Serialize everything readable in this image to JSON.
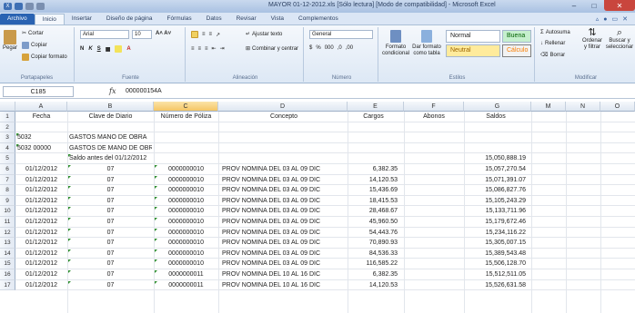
{
  "window": {
    "title": "MAYOR 01-12-2012.xls [Sólo lectura] [Modo de compatibilidad] - Microsoft Excel",
    "controls": [
      "–",
      "□",
      "✕"
    ]
  },
  "tabs": [
    "Archivo",
    "Inicio",
    "Insertar",
    "Diseño de página",
    "Fórmulas",
    "Datos",
    "Revisar",
    "Vista",
    "Complementos"
  ],
  "ribbon": {
    "clipboard": {
      "paste": "Pegar",
      "cut": "Cortar",
      "copy": "Copiar",
      "format_painter": "Copiar formato",
      "label": "Portapapeles"
    },
    "font": {
      "name": "Arial",
      "size": "10",
      "label": "Fuente"
    },
    "alignment": {
      "wrap": "Ajustar texto",
      "merge": "Combinar y centrar",
      "label": "Alineación"
    },
    "number": {
      "format": "General",
      "label": "Número"
    },
    "styles": {
      "conditional": "Formato condicional",
      "table": "Dar formato como tabla",
      "normal": "Normal",
      "good": "Buena",
      "neutral": "Neutral",
      "calc": "Cálculo",
      "label": "Estilos"
    },
    "cells": {
      "autosum": "Autosuma",
      "fill": "Rellenar",
      "clear": "Borrar",
      "sort": "Ordenar y filtrar",
      "find": "Buscar y seleccionar",
      "label": "Modificar"
    }
  },
  "formula_bar": {
    "name_box": "C185",
    "fx": "fx",
    "value": "000000154A"
  },
  "columns": [
    "A",
    "B",
    "C",
    "D",
    "E",
    "F",
    "G",
    "M",
    "N",
    "O"
  ],
  "rows": [
    {
      "n": "1",
      "a": "Fecha",
      "b": "Clave de Diario",
      "c": "Número de Póliza",
      "d": "Concepto",
      "e": "Cargos",
      "f": "Abonos",
      "g": "Saldos",
      "header": true
    },
    {
      "n": "2"
    },
    {
      "n": "3",
      "a": "5032",
      "b": "GASTOS MANO DE OBRA",
      "atri": true
    },
    {
      "n": "4",
      "a": "5032 00000",
      "b": "GASTOS DE MANO DE OBRA DIRECTA",
      "atri": true
    },
    {
      "n": "5",
      "b": "Saldo antes del 01/12/2012",
      "g": "15,050,888.19",
      "btri": true
    },
    {
      "n": "6",
      "a": "01/12/2012",
      "b": "07",
      "c": "0000000010",
      "d": "PROV NOMINA DEL 03 AL 09 DIC",
      "e": "6,382.35",
      "g": "15,057,270.54"
    },
    {
      "n": "7",
      "a": "01/12/2012",
      "b": "07",
      "c": "0000000010",
      "d": "PROV NOMINA DEL 03 AL 09 DIC",
      "e": "14,120.53",
      "g": "15,071,391.07"
    },
    {
      "n": "8",
      "a": "01/12/2012",
      "b": "07",
      "c": "0000000010",
      "d": "PROV NOMINA DEL 03 AL 09 DIC",
      "e": "15,436.69",
      "g": "15,086,827.76"
    },
    {
      "n": "9",
      "a": "01/12/2012",
      "b": "07",
      "c": "0000000010",
      "d": "PROV NOMINA DEL 03 AL 09 DIC",
      "e": "18,415.53",
      "g": "15,105,243.29"
    },
    {
      "n": "10",
      "a": "01/12/2012",
      "b": "07",
      "c": "0000000010",
      "d": "PROV NOMINA DEL 03 AL 09 DIC",
      "e": "28,468.67",
      "g": "15,133,711.96"
    },
    {
      "n": "11",
      "a": "01/12/2012",
      "b": "07",
      "c": "0000000010",
      "d": "PROV NOMINA DEL 03 AL 09 DIC",
      "e": "45,960.50",
      "g": "15,179,672.46"
    },
    {
      "n": "12",
      "a": "01/12/2012",
      "b": "07",
      "c": "0000000010",
      "d": "PROV NOMINA DEL 03 AL 09 DIC",
      "e": "54,443.76",
      "g": "15,234,116.22"
    },
    {
      "n": "13",
      "a": "01/12/2012",
      "b": "07",
      "c": "0000000010",
      "d": "PROV NOMINA DEL 03 AL 09 DIC",
      "e": "70,890.93",
      "g": "15,305,007.15"
    },
    {
      "n": "14",
      "a": "01/12/2012",
      "b": "07",
      "c": "0000000010",
      "d": "PROV NOMINA DEL 03 AL 09 DIC",
      "e": "84,536.33",
      "g": "15,389,543.48"
    },
    {
      "n": "15",
      "a": "01/12/2012",
      "b": "07",
      "c": "0000000010",
      "d": "PROV NOMINA DEL 03 AL 09 DIC",
      "e": "116,585.22",
      "g": "15,506,128.70"
    },
    {
      "n": "16",
      "a": "01/12/2012",
      "b": "07",
      "c": "0000000011",
      "d": "PROV NOMINA DEL 10 AL 16 DIC",
      "e": "6,382.35",
      "g": "15,512,511.05"
    },
    {
      "n": "17",
      "a": "01/12/2012",
      "b": "07",
      "c": "0000000011",
      "d": "PROV NOMINA DEL 10 AL 16 DIC",
      "e": "14,120.53",
      "g": "15,526,631.58"
    }
  ]
}
